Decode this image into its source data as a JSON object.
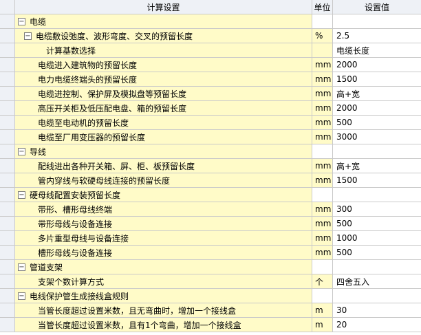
{
  "header": {
    "name": "计算设置",
    "unit": "单位",
    "value": "设置值"
  },
  "rows": [
    {
      "kind": "group",
      "name": "电缆",
      "unit": "",
      "value": ""
    },
    {
      "kind": "subgroup",
      "name": "电缆敷设弛度、波形弯度、交叉的预留长度",
      "unit": "%",
      "value": "2.5"
    },
    {
      "kind": "subleaf",
      "name": "计算基数选择",
      "unit": "",
      "value": "电缆长度"
    },
    {
      "kind": "leaf",
      "name": "电缆进入建筑物的预留长度",
      "unit": "mm",
      "value": "2000"
    },
    {
      "kind": "leaf",
      "name": "电力电缆终端头的预留长度",
      "unit": "mm",
      "value": "1500"
    },
    {
      "kind": "leaf",
      "name": "电缆进控制、保护屏及模拟盘等预留长度",
      "unit": "mm",
      "value": "高+宽"
    },
    {
      "kind": "leaf",
      "name": "高压开关柜及低压配电盘、箱的预留长度",
      "unit": "mm",
      "value": "2000"
    },
    {
      "kind": "leaf",
      "name": "电缆至电动机的预留长度",
      "unit": "mm",
      "value": "500"
    },
    {
      "kind": "leaf",
      "name": "电缆至厂用变压器的预留长度",
      "unit": "mm",
      "value": "3000"
    },
    {
      "kind": "group",
      "name": "导线",
      "unit": "",
      "value": ""
    },
    {
      "kind": "leaf",
      "name": "配线进出各种开关箱、屏、柜、板预留长度",
      "unit": "mm",
      "value": "高+宽"
    },
    {
      "kind": "leaf",
      "name": "管内穿线与软硬母线连接的预留长度",
      "unit": "mm",
      "value": "1500"
    },
    {
      "kind": "group",
      "name": "硬母线配置安装预留长度",
      "unit": "",
      "value": ""
    },
    {
      "kind": "leaf",
      "name": "带形、槽形母线终端",
      "unit": "mm",
      "value": "300"
    },
    {
      "kind": "leaf",
      "name": "带形母线与设备连接",
      "unit": "mm",
      "value": "500"
    },
    {
      "kind": "leaf",
      "name": "多片重型母线与设备连接",
      "unit": "mm",
      "value": "1000"
    },
    {
      "kind": "leaf",
      "name": "槽形母线与设备连接",
      "unit": "mm",
      "value": "500"
    },
    {
      "kind": "group",
      "name": "管道支架",
      "unit": "",
      "value": ""
    },
    {
      "kind": "leaf",
      "name": "支架个数计算方式",
      "unit": "个",
      "value": "四舍五入"
    },
    {
      "kind": "group",
      "name": "电线保护管生成接线盒规则",
      "unit": "",
      "value": ""
    },
    {
      "kind": "leaf",
      "name": "当管长度超过设置米数，且无弯曲时，增加一个接线盒",
      "unit": "m",
      "value": "30"
    },
    {
      "kind": "leaf",
      "name": "当管长度超过设置米数，且有1个弯曲，增加一个接线盒",
      "unit": "m",
      "value": "20"
    }
  ],
  "toggle_glyph": "−",
  "colors": {
    "yellow": "#fffbc8",
    "gutter": "#eef1f6",
    "grid": "#c9c9c9"
  }
}
